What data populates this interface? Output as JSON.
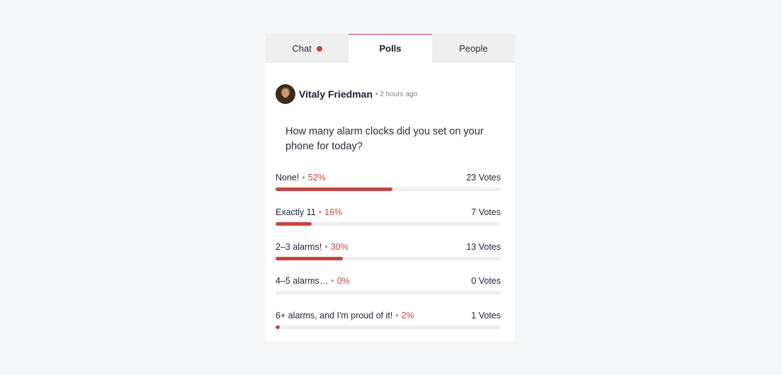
{
  "tabs": [
    {
      "label": "Chat",
      "has_notification": true
    },
    {
      "label": "Polls",
      "active": true
    },
    {
      "label": "People"
    }
  ],
  "post": {
    "author": "Vitaly Friedman",
    "separator": "•",
    "time": "2 hours ago",
    "question": "How many alarm clocks did you set on your phone for today?"
  },
  "options": [
    {
      "label": "None!",
      "sep": "•",
      "percent_text": "52%",
      "votes_text": "23 Votes",
      "fraction": 0.52
    },
    {
      "label": "Exactly 11",
      "sep": "•",
      "percent_text": "16%",
      "votes_text": "7 Votes",
      "fraction": 0.16
    },
    {
      "label": "2–3 alarms!",
      "sep": "•",
      "percent_text": "30%",
      "votes_text": "13 Votes",
      "fraction": 0.3
    },
    {
      "label": "4–5 alarms…",
      "sep": "•",
      "percent_text": "0%",
      "votes_text": "0 Votes",
      "fraction": 0.0
    },
    {
      "label": "6+ alarms, and I'm proud of it!",
      "sep": "•",
      "percent_text": "2%",
      "votes_text": "1 Votes",
      "fraction": 0.02
    }
  ],
  "colors": {
    "accent": "#c9443b",
    "tab_bg": "#efefef",
    "track": "#eeeef3",
    "page_bg": "#f5f6f8"
  }
}
